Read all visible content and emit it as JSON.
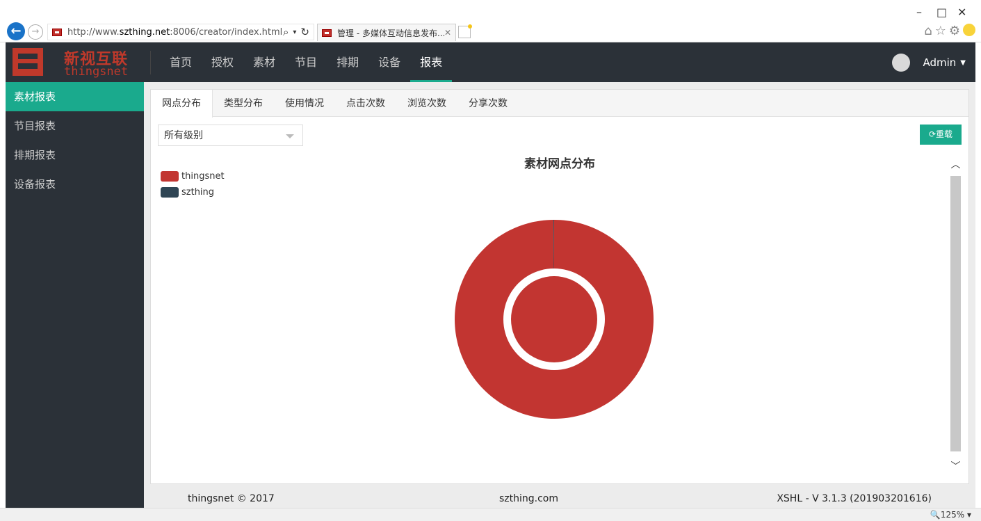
{
  "browser": {
    "url_prefix": "http://www.",
    "url_host": "szthing.net",
    "url_rest": ":8006/creator/index.html",
    "tab_title": "管理 - 多媒体互动信息发布...",
    "zoom": "125%"
  },
  "brand": {
    "name_cn": "新视互联",
    "name_en": "thingsnet"
  },
  "nav": {
    "items": [
      {
        "label": "首页"
      },
      {
        "label": "授权"
      },
      {
        "label": "素材"
      },
      {
        "label": "节目"
      },
      {
        "label": "排期"
      },
      {
        "label": "设备"
      },
      {
        "label": "报表"
      }
    ],
    "active_index": 6,
    "user": "Admin"
  },
  "sidebar": {
    "items": [
      {
        "label": "素材报表"
      },
      {
        "label": "节目报表"
      },
      {
        "label": "排期报表"
      },
      {
        "label": "设备报表"
      }
    ],
    "active_index": 0
  },
  "tabs": {
    "items": [
      {
        "label": "网点分布"
      },
      {
        "label": "类型分布"
      },
      {
        "label": "使用情况"
      },
      {
        "label": "点击次数"
      },
      {
        "label": "浏览次数"
      },
      {
        "label": "分享次数"
      }
    ],
    "active_index": 0
  },
  "filter": {
    "selected": "所有级别"
  },
  "reload_label": "重载",
  "chart_data": {
    "type": "pie",
    "title": "素材网点分布",
    "categories": [
      "thingsnet",
      "szthing"
    ],
    "values": [
      99.9,
      0.1
    ],
    "colors": [
      "#c23531",
      "#2f4554"
    ],
    "legend_position": "top-left"
  },
  "footer": {
    "left": "thingsnet © 2017",
    "center": "szthing.com",
    "right": "XSHL - V 3.1.3 (201903201616)"
  }
}
